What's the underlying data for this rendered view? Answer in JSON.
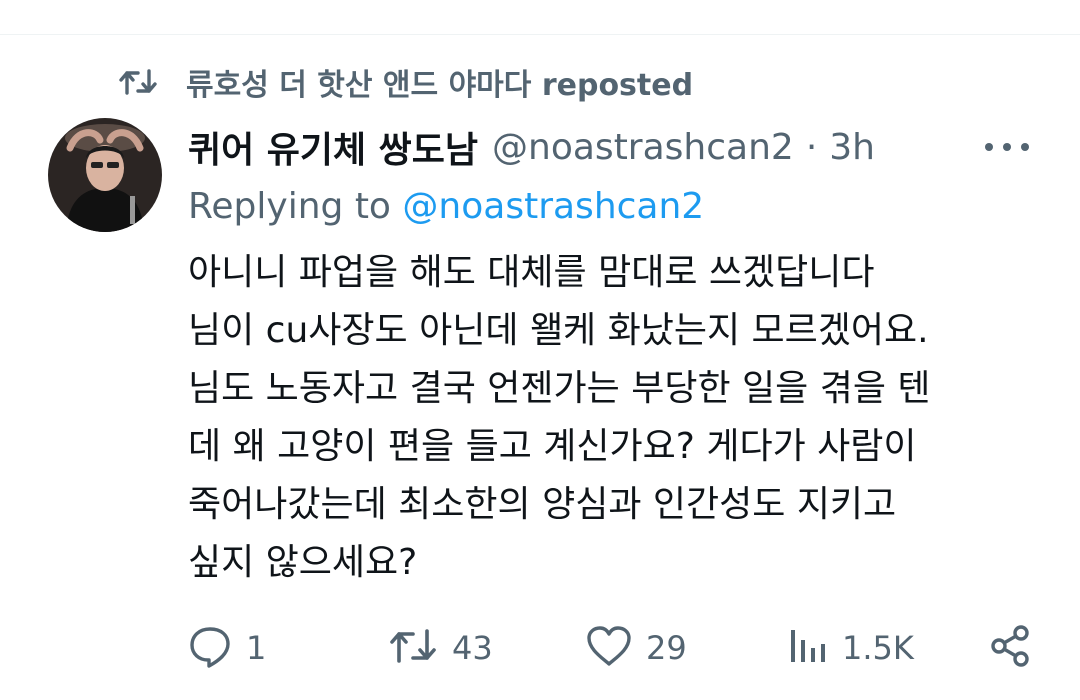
{
  "repost": {
    "icon": "repost-icon",
    "text": "류호성 더 핫산 앤드 야마다 reposted"
  },
  "tweet": {
    "display_name": "퀴어 유기체 쌍도남",
    "handle": "@noastrashcan2",
    "separator": "·",
    "time": "3h",
    "replying_label": "Replying to",
    "replying_to": "@noastrashcan2",
    "body_lines": [
      "아니니 파업을 해도 대체를 맘대로 쓰겠답니다",
      "님이 cu사장도 아닌데 왤케 화났는지 모르겠어요.",
      "님도 노동자고 결국 언젠가는 부당한 일을 겪을 텐",
      "데 왜 고양이 편을 들고 계신가요? 게다가 사람이",
      "죽어나갔는데 최소한의 양심과 인간성도 지키고",
      "싶지 않으세요?"
    ]
  },
  "actions": {
    "reply": {
      "icon": "reply-icon",
      "count": "1"
    },
    "retweet": {
      "icon": "repost-icon",
      "count": "43"
    },
    "like": {
      "icon": "heart-icon",
      "count": "29"
    },
    "views": {
      "icon": "views-icon",
      "count": "1.5K"
    },
    "share": {
      "icon": "share-icon"
    }
  },
  "colors": {
    "text": "#0f1419",
    "secondary": "#536471",
    "accent": "#1d9bf0",
    "divider": "#eff3f4"
  }
}
